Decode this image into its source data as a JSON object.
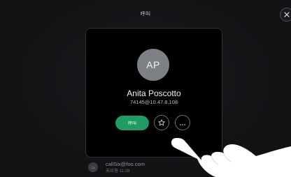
{
  "header": {
    "title": "呼叫"
  },
  "close_button": {
    "icon": "close-icon"
  },
  "contact": {
    "initials": "AP",
    "name": "Anita Poscotto",
    "address": "74145@10.47.8.108"
  },
  "actions": {
    "call_label": "呼叫",
    "favorite_icon": "star-icon",
    "more_icon": "more-horizontal-icon"
  },
  "recent": {
    "avatar_initials": "CA",
    "address": "callSix@foo.com",
    "time": "未应答 11:28"
  },
  "colors": {
    "background": "#111214",
    "card": "#000000",
    "accent_call": "#1f9b64",
    "avatar": "#7d8084"
  }
}
